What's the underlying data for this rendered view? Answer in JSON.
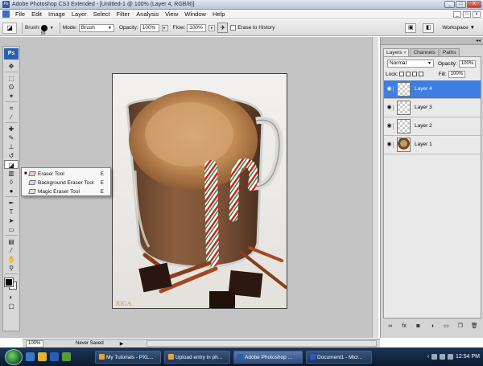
{
  "window": {
    "title": "Adobe Photoshop CS3 Extended - [Untitled-1 @ 100% (Layer 4, RGB/8)]",
    "min_label": "_",
    "max_label": "□",
    "close_label": "X"
  },
  "menu": {
    "items": [
      "File",
      "Edit",
      "Image",
      "Layer",
      "Select",
      "Filter",
      "Analysis",
      "View",
      "Window",
      "Help"
    ],
    "doc_controls": [
      "_",
      "□",
      "x"
    ]
  },
  "options": {
    "brush_label": "Brush:",
    "brush_size": "59",
    "mode_label": "Mode:",
    "mode_value": "Brush",
    "opacity_label": "Opacity:",
    "opacity_value": "100%",
    "flow_label": "Flow:",
    "flow_value": "100%",
    "erase_history_label": "Erase to History",
    "workspace_label": "Workspace"
  },
  "tools": {
    "badge": "Ps",
    "items": [
      {
        "name": "move-tool",
        "glyph": "✥"
      },
      {
        "name": "marquee-tool",
        "glyph": "⬚"
      },
      {
        "name": "lasso-tool",
        "glyph": "ʘ"
      },
      {
        "name": "magic-wand-tool",
        "glyph": "✶"
      },
      {
        "name": "crop-tool",
        "glyph": "⌗"
      },
      {
        "name": "slice-tool",
        "glyph": "∕"
      },
      {
        "name": "healing-brush-tool",
        "glyph": "✚"
      },
      {
        "name": "brush-tool",
        "glyph": "✎"
      },
      {
        "name": "clone-stamp-tool",
        "glyph": "⊥"
      },
      {
        "name": "history-brush-tool",
        "glyph": "↺"
      },
      {
        "name": "eraser-tool",
        "glyph": "◪",
        "selected": true
      },
      {
        "name": "gradient-tool",
        "glyph": "▥"
      },
      {
        "name": "blur-tool",
        "glyph": "◊"
      },
      {
        "name": "dodge-tool",
        "glyph": "●"
      },
      {
        "name": "pen-tool",
        "glyph": "✒"
      },
      {
        "name": "type-tool",
        "glyph": "T"
      },
      {
        "name": "path-selection-tool",
        "glyph": "➤"
      },
      {
        "name": "shape-tool",
        "glyph": "▭"
      },
      {
        "name": "notes-tool",
        "glyph": "▤"
      },
      {
        "name": "eyedropper-tool",
        "glyph": "⁄"
      },
      {
        "name": "hand-tool",
        "glyph": "✋"
      },
      {
        "name": "zoom-tool",
        "glyph": "⚲"
      }
    ]
  },
  "flyout": [
    {
      "label": "Eraser Tool",
      "key": "E",
      "active": true
    },
    {
      "label": "Background Eraser Tool",
      "key": "E",
      "active": false
    },
    {
      "label": "Magic Eraser Tool",
      "key": "E",
      "active": false
    }
  ],
  "layers_panel": {
    "tabs": [
      {
        "label": "Layers",
        "active": true
      },
      {
        "label": "Channels",
        "active": false
      },
      {
        "label": "Paths",
        "active": false
      }
    ],
    "blend_mode": "Normal",
    "opacity_label": "Opacity:",
    "opacity_value": "100%",
    "lock_label": "Lock:",
    "fill_label": "Fill:",
    "fill_value": "100%",
    "layers": [
      {
        "name": "Layer 4",
        "active": true,
        "thumb": "transparent"
      },
      {
        "name": "Layer 3",
        "active": false,
        "thumb": "transparent"
      },
      {
        "name": "Layer 2",
        "active": false,
        "thumb": "transparent"
      },
      {
        "name": "Layer 1",
        "active": false,
        "thumb": "photo"
      }
    ],
    "footer_icons": [
      "link-icon",
      "fx-icon",
      "mask-icon",
      "adjustment-icon",
      "group-icon",
      "new-layer-icon",
      "trash-icon"
    ]
  },
  "canvas": {
    "signature": "RIGA"
  },
  "status": {
    "zoom": "100%",
    "doc_info": "Never Saved"
  },
  "taskbar": {
    "tasks": [
      {
        "label": "My Tutorials - PXL...",
        "icon_color": "#e8a33c",
        "active": false
      },
      {
        "label": "Upload entry in ph...",
        "icon_color": "#e8a33c",
        "active": false
      },
      {
        "label": "Adobe Photoshop ...",
        "icon_color": "#2b5fb3",
        "active": true
      },
      {
        "label": "Document1 - Micr...",
        "icon_color": "#2c5ac8",
        "active": false
      }
    ],
    "clock": "12:54 PM"
  }
}
